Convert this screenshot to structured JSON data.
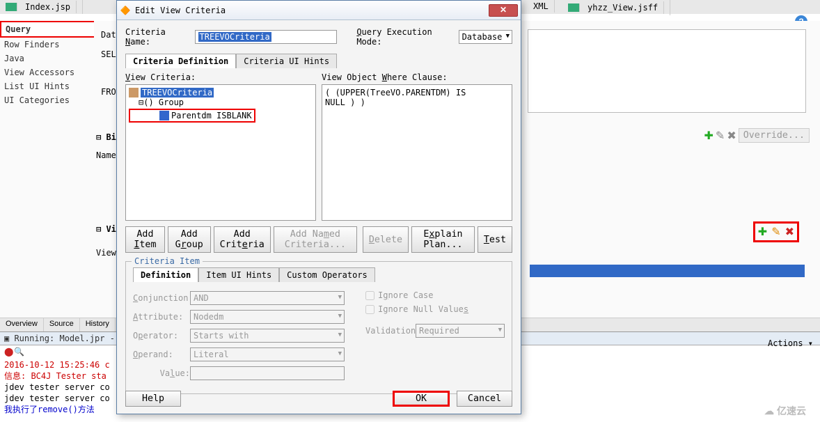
{
  "top_tabs": {
    "t1": "Index.jsp",
    "t2": "XML",
    "t3": "yhzz_View.jsff"
  },
  "left_panel": {
    "items": [
      "Query",
      "Row Finders",
      "Java",
      "View Accessors",
      "List UI Hints",
      "UI Categories"
    ]
  },
  "bg_words": {
    "date": "Data",
    "sel": "SELE",
    "from": "FROM",
    "bi": "Bi",
    "name": "Name",
    "vi": "Vi",
    "view": "View"
  },
  "right_toolbar": {
    "override": "Override..."
  },
  "bottom_tabs": {
    "overview": "Overview",
    "source": "Source",
    "history": "History"
  },
  "console": {
    "title": "Running: Model.jpr -",
    "line1": "2016-10-12 15:25:46 c",
    "line2": "信息: BC4J Tester sta",
    "line3": "jdev tester server co",
    "line4": "jdev tester server co",
    "line5": "我执行了remove()方法"
  },
  "actions": "Actions",
  "dialog": {
    "title": "Edit View Criteria",
    "criteria_name_lbl": "Criteria Name:",
    "criteria_name_val": "TREEVOCriteria",
    "exec_mode_lbl": "Query Execution Mode:",
    "exec_mode_val": "Database",
    "tab_def": "Criteria Definition",
    "tab_hints": "Criteria UI Hints",
    "view_criteria_lbl": "View Criteria:",
    "where_lbl": "View Object Where Clause:",
    "tree": {
      "root": "TREEVOCriteria",
      "group": "() Group",
      "leaf": "Parentdm ISBLANK"
    },
    "where_text1": "( (UPPER(TreeVO.PARENTDM) IS",
    "where_text2": "NULL ) )",
    "btns": {
      "add_item": "Add Item",
      "add_group": "Add Group",
      "add_criteria": "Add Criteria",
      "add_named": "Add Named Criteria...",
      "delete": "Delete",
      "explain": "Explain Plan...",
      "test": "Test"
    },
    "ci": {
      "legend": "Criteria Item",
      "tab_def": "Definition",
      "tab_ih": "Item UI Hints",
      "tab_co": "Custom Operators",
      "conj_lbl": "Conjunction:",
      "conj_val": "AND",
      "attr_lbl": "Attribute:",
      "attr_val": "Nodedm",
      "op_lbl": "Operator:",
      "op_val": "Starts with",
      "opd_lbl": "Operand:",
      "opd_val": "Literal",
      "val_lbl": "Value:",
      "chk_case": "Ignore Case",
      "chk_null": "Ignore Null Values",
      "valid_lbl": "Validation:",
      "valid_val": "Required"
    },
    "footer": {
      "help": "Help",
      "ok": "OK",
      "cancel": "Cancel"
    }
  },
  "watermark": "亿速云"
}
